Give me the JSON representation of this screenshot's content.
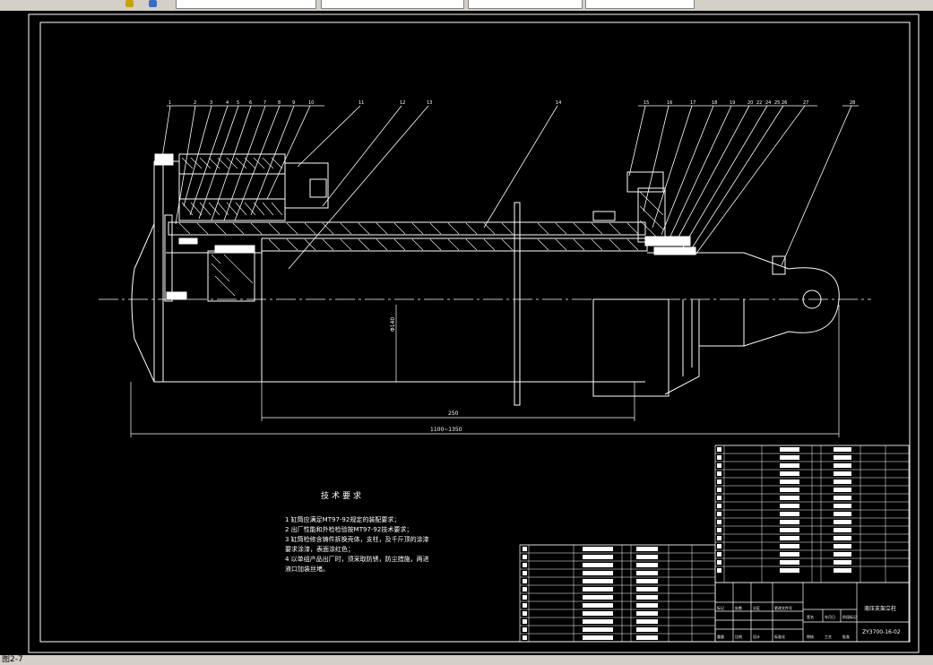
{
  "tech_requirements": {
    "heading": "技术要求",
    "items": [
      "1 缸筒应满足MT97-92规定的装配要求；",
      "2 出厂性能和外检检验按MT97-92技术要求；",
      "3 缸筒检修含铸件拆换壳体，支柱，及千斤顶的涂漆",
      "要求涂漆，表面涂红色；",
      "4 以单组产品出厂时，须采取防锈，防尘措施，两进",
      "液口加装丝堵。"
    ]
  },
  "dimensions": {
    "stroke": "250",
    "overall": "1100~1350",
    "bore": "Φ140"
  },
  "part_numbers": [
    "1",
    "2",
    "3",
    "4",
    "5",
    "6",
    "7",
    "8",
    "9",
    "10",
    "11",
    "12",
    "13",
    "14",
    "15",
    "16",
    "17",
    "18",
    "19",
    "20",
    "22",
    "24",
    "25",
    "26",
    "27",
    "28"
  ],
  "title_block": {
    "name": "液压支架立柱",
    "code": "ZY3700-16-02",
    "labels": [
      "标记",
      "处数",
      "分区",
      "更改文件号",
      "签名",
      "年月日",
      "阶段标记",
      "重量",
      "比例",
      "设计",
      "标准化",
      "审核",
      "工艺",
      "批准"
    ]
  },
  "status_bar": {
    "text": "图2-7"
  }
}
